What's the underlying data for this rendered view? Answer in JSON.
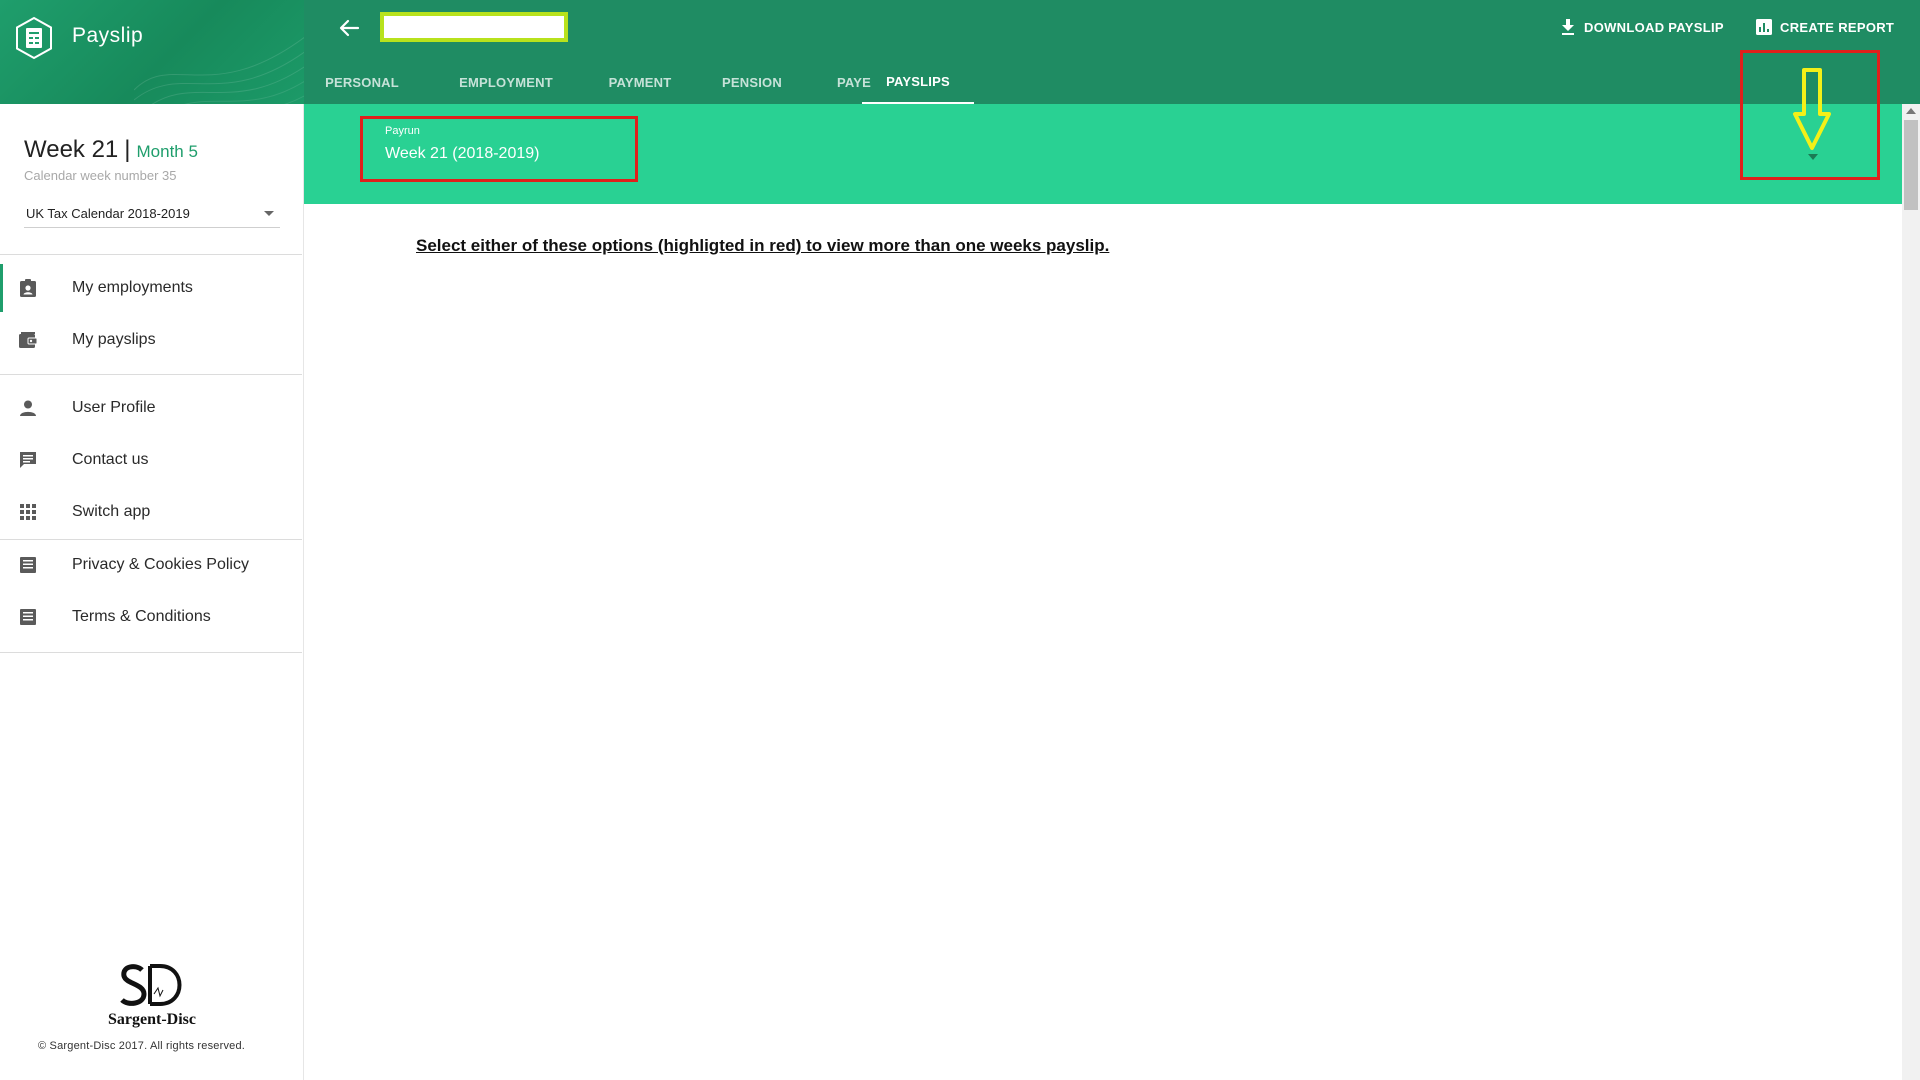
{
  "app": {
    "title": "Payslip"
  },
  "sidebar": {
    "period": {
      "week": "Week 21",
      "separator": "|",
      "month": "Month 5",
      "calendar_week": "Calendar week number 35"
    },
    "calendar_select": {
      "value": "UK Tax Calendar 2018-2019"
    },
    "items": [
      {
        "label": "My employments",
        "icon": "badge-icon",
        "active": true
      },
      {
        "label": "My payslips",
        "icon": "wallet-icon",
        "active": false
      },
      {
        "label": "User Profile",
        "icon": "person-icon",
        "active": false
      },
      {
        "label": "Contact us",
        "icon": "chat-icon",
        "active": false
      },
      {
        "label": "Switch app",
        "icon": "apps-grid-icon",
        "active": false
      },
      {
        "label": "Privacy & Cookies Policy",
        "icon": "document-icon",
        "active": false
      },
      {
        "label": "Terms & Conditions",
        "icon": "document-icon",
        "active": false
      }
    ],
    "footer": {
      "logo_name": "Sargent-Disc",
      "copyright": "© Sargent-Disc 2017. All rights reserved."
    }
  },
  "header": {
    "name_field_value": "",
    "actions": {
      "download": "DOWNLOAD PAYSLIP",
      "report": "CREATE REPORT"
    },
    "tabs": [
      {
        "label": "PERSONAL",
        "active": false
      },
      {
        "label": "EMPLOYMENT",
        "active": false
      },
      {
        "label": "PAYMENT",
        "active": false
      },
      {
        "label": "PENSION",
        "active": false
      },
      {
        "label": "PAYE",
        "active": false
      },
      {
        "label": "PAYSLIPS",
        "active": true
      }
    ]
  },
  "payrun": {
    "label": "Payrun",
    "value": "Week 21 (2018-2019)"
  },
  "main": {
    "instruction": "Select either of these options (highligted in red) to view more than one weeks payslip."
  },
  "colors": {
    "brand": "#1f9e6c",
    "topbar": "#1f8c63",
    "banner": "#29d193",
    "highlight_red": "#e0201b",
    "highlight_yellow": "#f4f018",
    "field_outline": "#b8e21c"
  }
}
